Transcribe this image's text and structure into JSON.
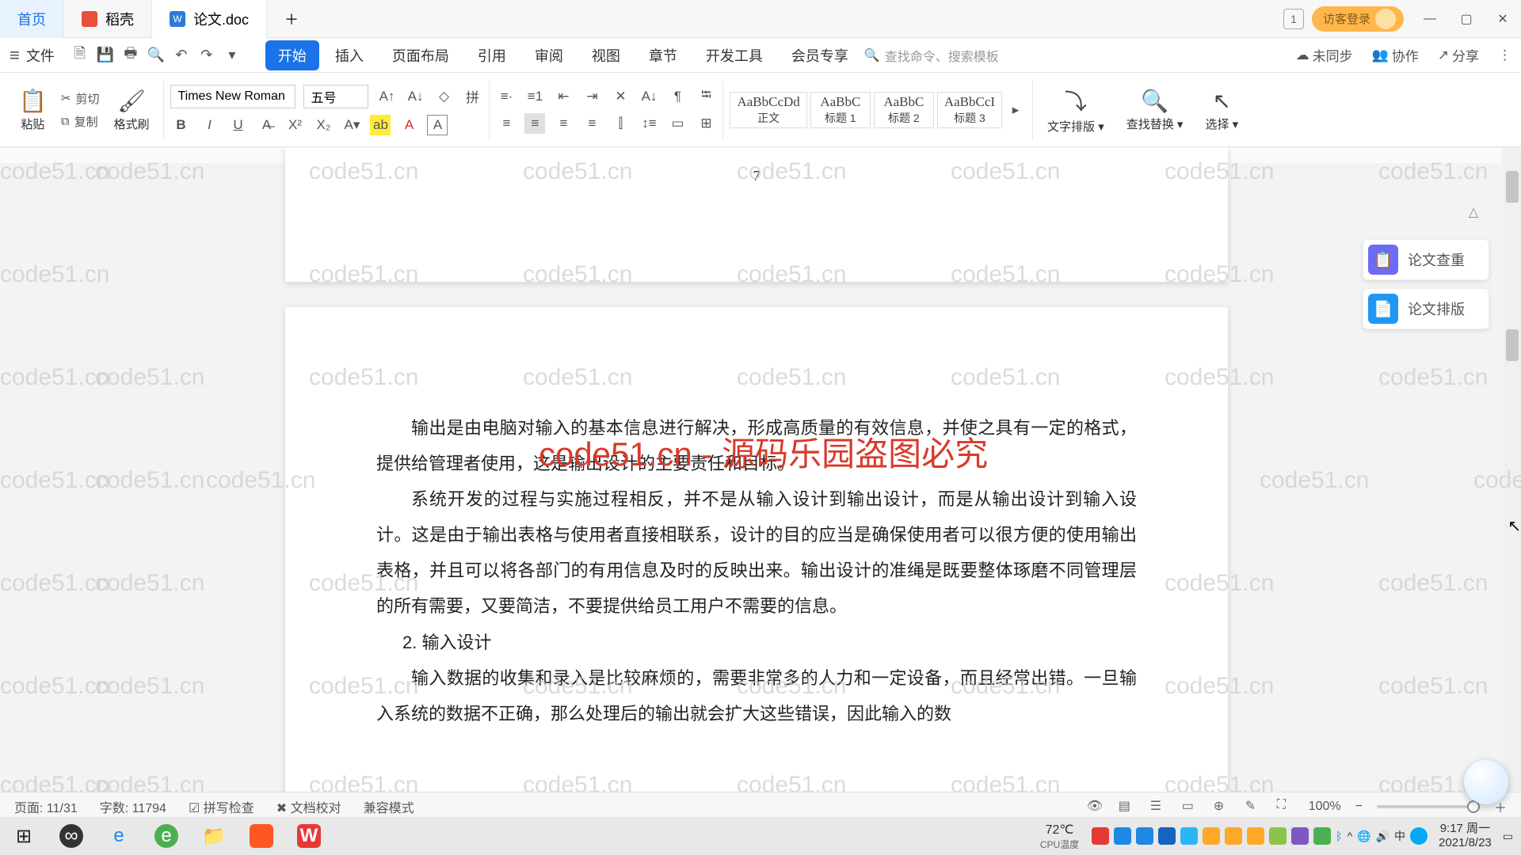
{
  "tabs": {
    "home": "首页",
    "daoke": "稻壳",
    "doc": "论文.doc"
  },
  "titlebar": {
    "badge": "1",
    "login": "访客登录"
  },
  "menubar": {
    "file": "文件",
    "items": [
      "开始",
      "插入",
      "页面布局",
      "引用",
      "审阅",
      "视图",
      "章节",
      "开发工具",
      "会员专享"
    ],
    "search_placeholder": "查找命令、搜索模板",
    "unsync": "未同步",
    "coop": "协作",
    "share": "分享"
  },
  "ribbon": {
    "paste": "粘贴",
    "cut": "剪切",
    "copy": "复制",
    "format": "格式刷",
    "font": "Times New Roman",
    "size": "五号",
    "styles": [
      {
        "pv": "AaBbCcDd",
        "name": "正文"
      },
      {
        "pv": "AaBbC",
        "name": "标题 1"
      },
      {
        "pv": "AaBbC",
        "name": "标题 2"
      },
      {
        "pv": "AaBbCcI",
        "name": "标题 3"
      }
    ],
    "textdir": "文字排版",
    "findrep": "查找替换",
    "select": "选择"
  },
  "side": {
    "check": "论文查重",
    "layout": "论文排版"
  },
  "doc": {
    "pgnum": "7",
    "p1": "输出是由电脑对输入的基本信息进行解决，形成高质量的有效信息，并使之具有一定的格式，提供给管理者使用，这是输出设计的主要责任和目标。",
    "p2": "系统开发的过程与实施过程相反，并不是从输入设计到输出设计，而是从输出设计到输入设计。这是由于输出表格与使用者直接相联系，设计的目的应当是确保使用者可以很方便的使用输出表格，并且可以将各部门的有用信息及时的反映出来。输出设计的准绳是既要整体琢磨不同管理层的所有需要，又要简洁，不要提供给员工用户不需要的信息。",
    "h2": "2. 输入设计",
    "p3": "输入数据的收集和录入是比较麻烦的，需要非常多的人力和一定设备，而且经常出错。一旦输入系统的数据不正确，那么处理后的输出就会扩大这些错误，因此输入的数"
  },
  "status": {
    "page": "页面: 11/31",
    "words": "字数: 11794",
    "spell": "拼写检查",
    "proof": "文档校对",
    "compat": "兼容模式",
    "zoom": "100%"
  },
  "taskbar": {
    "temp_lbl": "CPU温度",
    "temp": "72℃",
    "time": "9:17",
    "day": "周一",
    "date": "2021/8/23"
  },
  "watermark": "code51.cn",
  "watermark_red": "code51.cn - 源码乐园盗图必究"
}
